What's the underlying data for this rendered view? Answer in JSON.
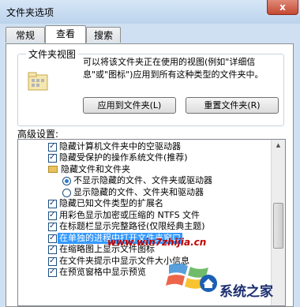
{
  "window": {
    "title": "文件夹选项",
    "close_label": "x"
  },
  "tabs": [
    {
      "label": "常规",
      "active": false
    },
    {
      "label": "查看",
      "active": true
    },
    {
      "label": "搜索",
      "active": false
    }
  ],
  "folder_views": {
    "group_label": "文件夹视图",
    "description": "可以将该文件夹正在使用的视图(例如\"详细信息\"或\"图标\")应用到所有这种类型的文件夹中。",
    "apply_button": "应用到文件夹(L)",
    "reset_button": "重置文件夹(R)"
  },
  "advanced": {
    "label": "高级设置:",
    "items": [
      {
        "type": "checkbox",
        "label": "隐藏计算机文件夹中的空驱动器",
        "checked": true,
        "indent": 0
      },
      {
        "type": "checkbox",
        "label": "隐藏受保护的操作系统文件(推荐)",
        "checked": true,
        "indent": 0
      },
      {
        "type": "folder",
        "label": "隐藏文件和文件夹",
        "indent": 0
      },
      {
        "type": "radio",
        "label": "不显示隐藏的文件、文件夹或驱动器",
        "checked": true,
        "indent": 1
      },
      {
        "type": "radio",
        "label": "显示隐藏的文件、文件夹和驱动器",
        "checked": false,
        "indent": 1
      },
      {
        "type": "checkbox",
        "label": "隐藏已知文件类型的扩展名",
        "checked": true,
        "indent": 0
      },
      {
        "type": "checkbox",
        "label": "用彩色显示加密或压缩的 NTFS 文件",
        "checked": true,
        "indent": 0
      },
      {
        "type": "checkbox",
        "label": "在标题栏显示完整路径(仅限经典主题)",
        "checked": true,
        "indent": 0
      },
      {
        "type": "checkbox",
        "label": "在单独的进程中打开文件夹窗口",
        "checked": true,
        "indent": 0,
        "selected": true
      },
      {
        "type": "checkbox",
        "label": "在缩略图上显示文件图标",
        "checked": true,
        "indent": 0
      },
      {
        "type": "checkbox",
        "label": "在文件夹提示中显示文件大小信息",
        "checked": true,
        "indent": 0
      },
      {
        "type": "checkbox",
        "label": "在预览窗格中显示预览",
        "checked": true,
        "indent": 0
      }
    ]
  },
  "watermarks": {
    "site": "www.win7zhijia.cn",
    "brand": "系统之家"
  }
}
